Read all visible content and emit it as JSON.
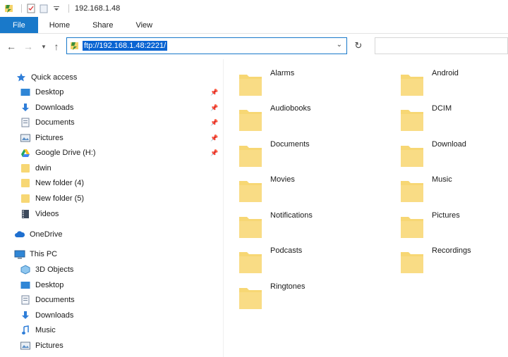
{
  "window": {
    "title": "192.168.1.48"
  },
  "ribbon": {
    "tabs": [
      "File",
      "Home",
      "Share",
      "View"
    ]
  },
  "address": {
    "path": "ftp://192.168.1.48:2221/"
  },
  "sidebar": {
    "quick_access": {
      "label": "Quick access",
      "items": [
        {
          "label": "Desktop",
          "icon": "desktop-icon",
          "pinned": true
        },
        {
          "label": "Downloads",
          "icon": "downloads-icon",
          "pinned": true
        },
        {
          "label": "Documents",
          "icon": "documents-icon",
          "pinned": true
        },
        {
          "label": "Pictures",
          "icon": "pictures-icon",
          "pinned": true
        },
        {
          "label": "Google Drive (H:)",
          "icon": "google-drive-icon",
          "pinned": true
        },
        {
          "label": "dwin",
          "icon": "folder-icon",
          "pinned": false
        },
        {
          "label": "New folder (4)",
          "icon": "folder-icon",
          "pinned": false
        },
        {
          "label": "New folder (5)",
          "icon": "folder-icon",
          "pinned": false
        },
        {
          "label": "Videos",
          "icon": "videos-icon",
          "pinned": false
        }
      ]
    },
    "onedrive": {
      "label": "OneDrive"
    },
    "this_pc": {
      "label": "This PC",
      "items": [
        {
          "label": "3D Objects",
          "icon": "3d-objects-icon"
        },
        {
          "label": "Desktop",
          "icon": "desktop-icon"
        },
        {
          "label": "Documents",
          "icon": "documents-icon"
        },
        {
          "label": "Downloads",
          "icon": "downloads-icon"
        },
        {
          "label": "Music",
          "icon": "music-icon"
        },
        {
          "label": "Pictures",
          "icon": "pictures-icon"
        }
      ]
    }
  },
  "content": {
    "folders": [
      "Alarms",
      "Android",
      "Audiobooks",
      "DCIM",
      "Documents",
      "Download",
      "Movies",
      "Music",
      "Notifications",
      "Pictures",
      "Podcasts",
      "Recordings",
      "Ringtones"
    ]
  },
  "colors": {
    "accent": "#1979ca",
    "folder": "#f7d774",
    "selection": "#0a64d2"
  }
}
